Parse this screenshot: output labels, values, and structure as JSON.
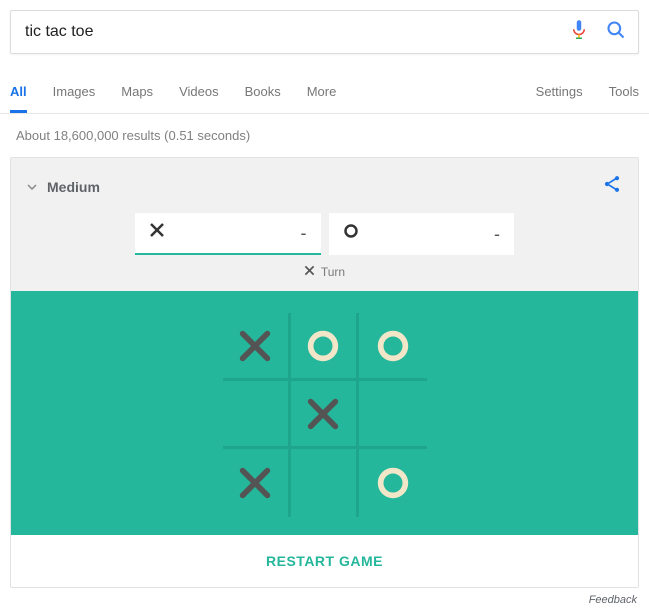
{
  "search": {
    "query": "tic tac toe"
  },
  "tabs": {
    "all": "All",
    "images": "Images",
    "maps": "Maps",
    "videos": "Videos",
    "books": "Books",
    "more": "More",
    "settings": "Settings",
    "tools": "Tools"
  },
  "result_stats": "About 18,600,000 results (0.51 seconds)",
  "game": {
    "difficulty": "Medium",
    "score": {
      "x": "-",
      "o": "-"
    },
    "turn_label": "Turn",
    "turn_mark": "X",
    "restart_label": "RESTART GAME",
    "board": [
      [
        "X",
        "O",
        "O"
      ],
      [
        "",
        "X",
        ""
      ],
      [
        "X",
        "",
        "O"
      ]
    ],
    "colors": {
      "board_bg": "#25b79b",
      "x": "#545454",
      "o": "#f2e6c9"
    }
  },
  "feedback_label": "Feedback"
}
